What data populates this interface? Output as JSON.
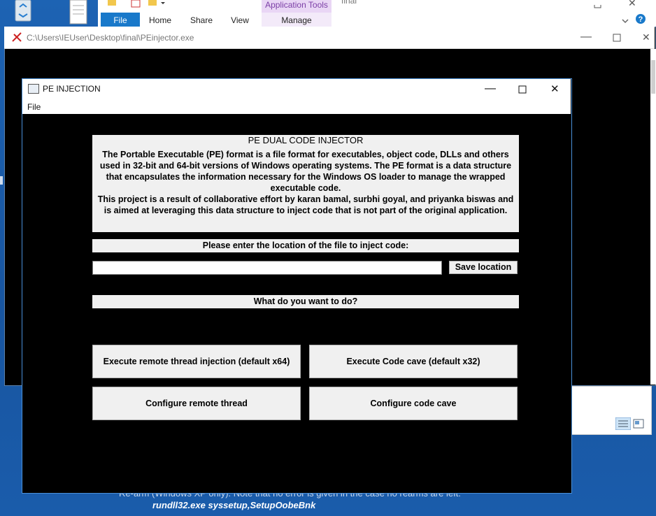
{
  "explorer": {
    "tabs": [
      "File",
      "Home",
      "Share",
      "View",
      "Manage"
    ],
    "context_tab": "Application Tools",
    "title_fragment": "final"
  },
  "console": {
    "title": "C:\\Users\\IEUser\\Desktop\\final\\PEinjector.exe"
  },
  "background_text": {
    "line1": "Re-arm (Windows XP only). Note that no error is given in the case no rearms are left.",
    "line2": "rundll32.exe syssetup,SetupOobeBnk"
  },
  "app": {
    "title": "PE INJECTION",
    "menu": [
      "File"
    ],
    "description_title": "PE DUAL CODE INJECTOR",
    "description_body": "The Portable Executable (PE) format is a file format for executables, object code, DLLs and others used in 32-bit and 64-bit versions of Windows operating systems. The PE format is a data structure that encapsulates the information necessary for the Windows OS loader to manage the wrapped executable code.\nThis project is a result of collaborative effort by karan bamal, surbhi goyal, and priyanka biswas and is aimed at leveraging this data structure to inject code that is not part of the original application.",
    "location_prompt": "Please enter the location of the file to inject code:",
    "location_value": "",
    "save_label": "Save location",
    "action_prompt": "What do you want to do?",
    "buttons": {
      "remote_thread": "Execute remote thread injection (default x64)",
      "code_cave": "Execute Code cave (default x32)",
      "config_remote": "Configure remote thread",
      "config_cave": "Configure code cave"
    }
  },
  "colors": {
    "desktop": "#1c5fa8",
    "ribbon_file_tab": "#1979ca",
    "app_background": "#000000",
    "panel": "#f0f0f0"
  },
  "icons": [
    "recycle-bin-icon",
    "document-icon",
    "minimize-icon",
    "maximize-icon",
    "close-icon",
    "help-icon",
    "chevron-down-icon"
  ]
}
